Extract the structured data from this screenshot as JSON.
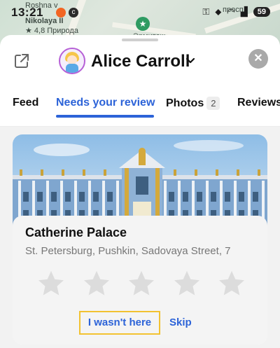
{
  "map": {
    "labels": [
      "Roshna v",
      "Nikolaya II",
      "★ 4,8 Природа",
      "Эрмитаж",
      "просп"
    ]
  },
  "status_bar": {
    "time": "13:21",
    "battery": "59"
  },
  "header": {
    "user_name": "Alice Carroll",
    "share_icon": "share-icon",
    "close_icon": "close-icon",
    "close_glyph": "✕"
  },
  "tabs": [
    {
      "label": "Feed"
    },
    {
      "label": "Needs your review",
      "active": true
    },
    {
      "label": "Photos",
      "count": "2"
    },
    {
      "label": "Reviews"
    }
  ],
  "card": {
    "title": "Catherine Palace",
    "address": "St. Petersburg, Pushkin, Sadovaya Street, 7",
    "rating": 0,
    "max_rating": 5,
    "wasnt_here_label": "I wasn't here",
    "skip_label": "Skip"
  },
  "colors": {
    "accent": "#2c63d8",
    "highlight_border": "#f2c231",
    "star_empty": "#dcdcdc"
  }
}
